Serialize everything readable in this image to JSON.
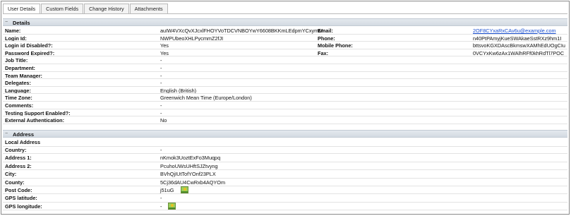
{
  "tabs": [
    {
      "label": "User Details"
    },
    {
      "label": "Custom Fields"
    },
    {
      "label": "Change History"
    },
    {
      "label": "Attachments"
    }
  ],
  "details": {
    "title": "Details",
    "rows_left": [
      {
        "label": "Name:",
        "value": "auIW4VXcQvXJcxlFHOYVoTDCVNBOYwY6608BKKmLEdpmYCxymM"
      },
      {
        "label": "Login Id:",
        "value": "NWPUbeoXHLPycmmZ2fJI"
      },
      {
        "label": "Login id Disabled?:",
        "value": "Yes"
      },
      {
        "label": "Password Expired?:",
        "value": "Yes"
      },
      {
        "label": "Job Title:",
        "value": "-"
      },
      {
        "label": "Department:",
        "value": "-"
      },
      {
        "label": "Team Manager:",
        "value": "-"
      },
      {
        "label": "Delegates:",
        "value": "-"
      },
      {
        "label": "Language:",
        "value": "English (British)"
      },
      {
        "label": "Time Zone:",
        "value": "Greenwich Mean Time (Europe/London)"
      },
      {
        "label": "Comments:",
        "value": "-"
      },
      {
        "label": "Testing Support Enabled?:",
        "value": "-"
      },
      {
        "label": "External Authentication:",
        "value": "No"
      }
    ],
    "rows_right": [
      {
        "label": "Email:",
        "value": "2OF8CYxaRxCAv6u@example.com",
        "link": true
      },
      {
        "label": "Phone:",
        "value": "n40PtPAmyjKueSWAkaeSstRXz9hm1I"
      },
      {
        "label": "Mobile Phone:",
        "value": "bttsvoKGXDAscBkmswXAMhEdUOgCIu"
      },
      {
        "label": "Fax:",
        "value": "0VCYxKw6zAx1WAlhRFf0khRdTl7POC"
      }
    ]
  },
  "address": {
    "title": "Address",
    "subheading": "Local Address",
    "rows": [
      {
        "label": "Country:",
        "value": "-"
      },
      {
        "label": "Address 1:",
        "value": "nKmok3UoztExFo3Muqpq"
      },
      {
        "label": "Address 2:",
        "value": "PcuhoUWsUHftSJZtvyng"
      },
      {
        "label": "City:",
        "value": "BVhQjIUtTofYOnf23PLX"
      },
      {
        "label": "County:",
        "value": "5Cj36dAU4CwRxb4AQYOm"
      },
      {
        "label": "Post Code:",
        "value": "j51uG",
        "icon": "map-icon"
      },
      {
        "label": "GPS latitude:",
        "value": "-"
      },
      {
        "label": "GPS longitude:",
        "value": "-",
        "icon": "map-icon"
      }
    ]
  },
  "icons": {
    "collapse": "collapse-icon",
    "map": "map-icon"
  },
  "colors": {
    "link": "#1a4fd0",
    "section_bg": "#dbe1e7",
    "map_icon": "#9ccf5a"
  }
}
